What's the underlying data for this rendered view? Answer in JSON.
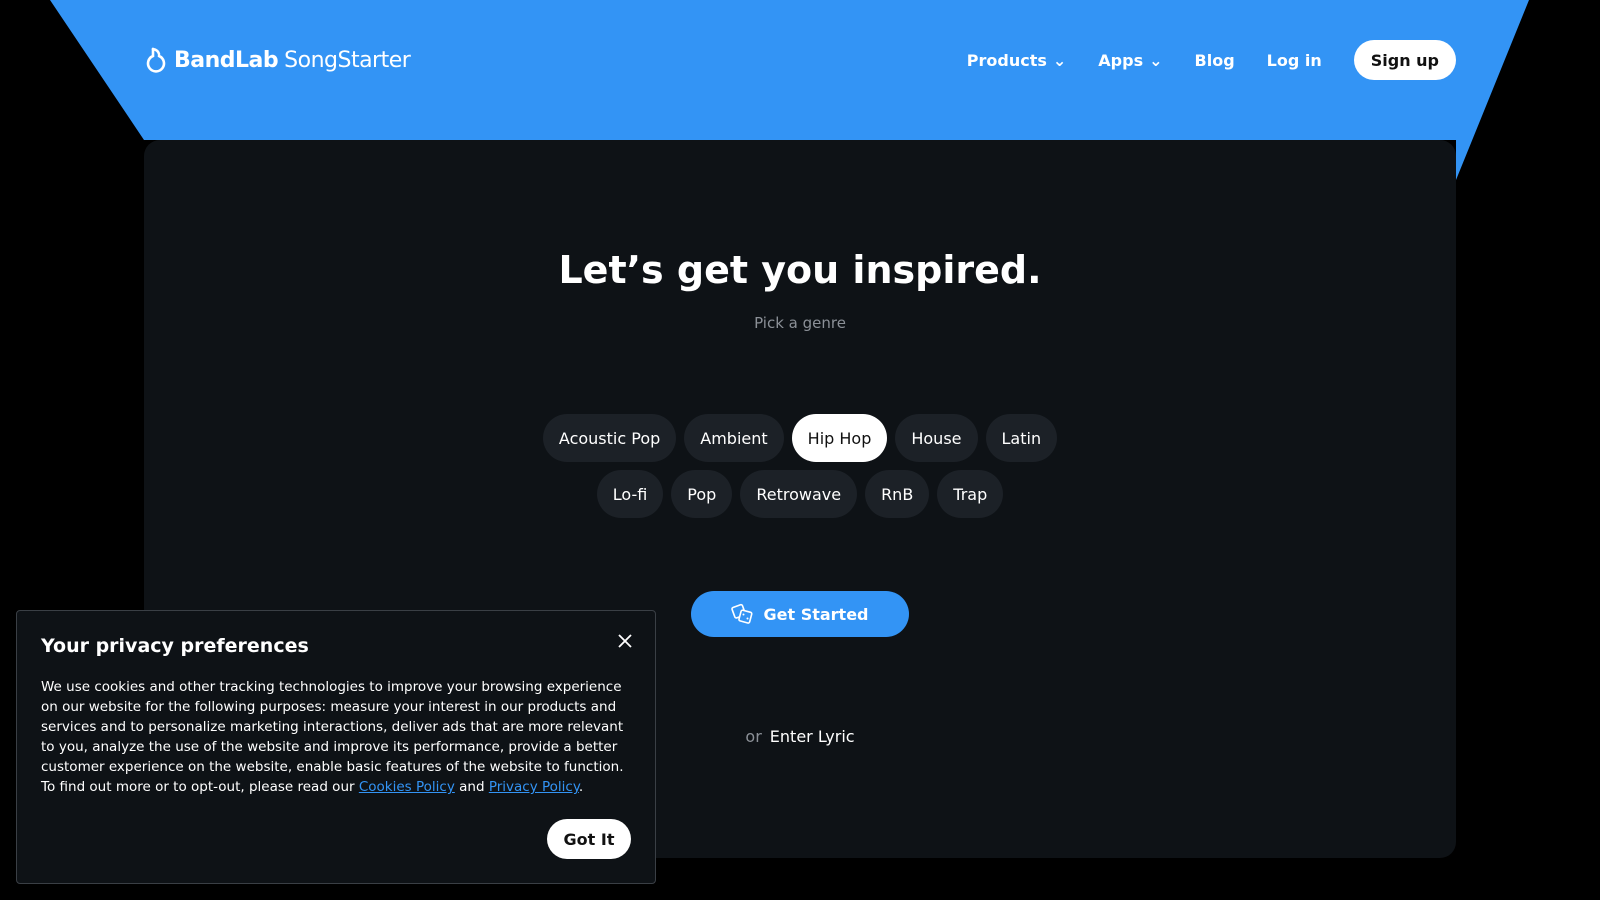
{
  "colors": {
    "brand": "#3394f5",
    "background": "#000000",
    "card": "#0e1216"
  },
  "header": {
    "logo_bold": "BandLab",
    "logo_light": "SongStarter",
    "logo_icon": "bandlab-flask-icon",
    "nav": {
      "products": "Products",
      "apps": "Apps",
      "blog": "Blog",
      "login": "Log in",
      "signup": "Sign up"
    }
  },
  "main": {
    "title": "Let’s get you inspired.",
    "subtitle": "Pick a genre",
    "genres_row1": [
      "Acoustic Pop",
      "Ambient",
      "Hip Hop",
      "House",
      "Latin"
    ],
    "genres_row2": [
      "Lo-fi",
      "Pop",
      "Retrowave",
      "RnB",
      "Trap"
    ],
    "selected_genre": "Hip Hop",
    "get_started": "Get Started",
    "get_started_icon": "dice-icon",
    "or": "or",
    "enter_lyric": "Enter Lyric"
  },
  "privacy": {
    "title": "Your privacy preferences",
    "body": "We use cookies and other tracking technologies to improve your browsing experience on our website for the following purposes: measure your interest in our products and services and to personalize marketing interactions, deliver ads that are more relevant to you, analyze the use of the website and improve its performance, provide a better customer experience on the website, enable basic features of the website to function. To find out more or to opt-out, please read our ",
    "cookies_link": "Cookies Policy",
    "and": " and ",
    "privacy_link": "Privacy Policy",
    "end": ".",
    "got_it": "Got It"
  }
}
